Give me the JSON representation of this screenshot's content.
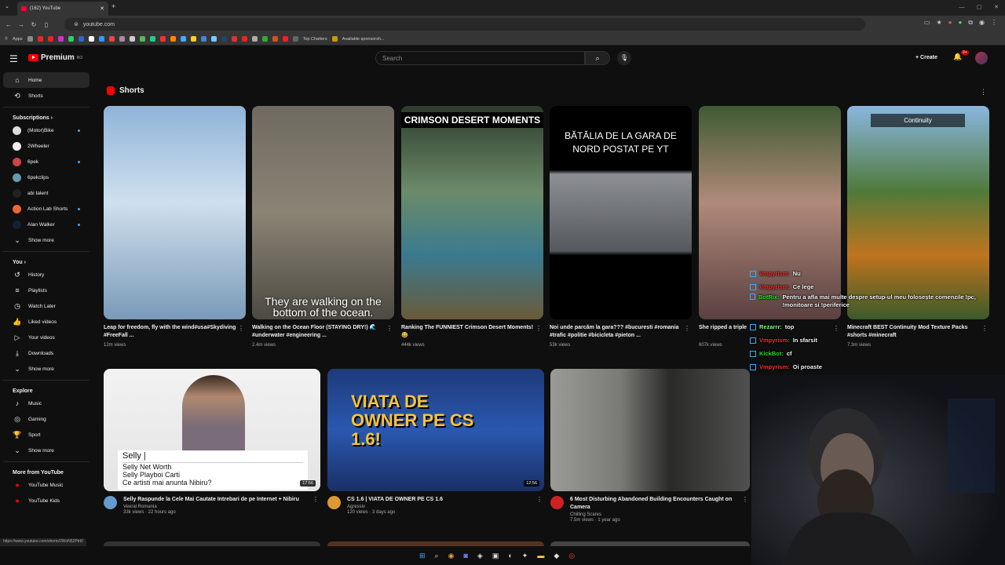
{
  "browser": {
    "tab_title": "(162) YouTube",
    "new_tab": "+",
    "url": "youtube.com",
    "bookmarks": [
      "Apps",
      "Top Chatters",
      "Available sponsorsh..."
    ],
    "window_controls": [
      "—",
      "▢",
      "✕"
    ]
  },
  "header": {
    "logo": "Premium",
    "logo_region": "RO",
    "search_placeholder": "Search",
    "create_label": "Create",
    "notif_count": "9+"
  },
  "sidebar": {
    "main": [
      {
        "label": "Home",
        "icon": "home-icon",
        "glyph": "⌂"
      },
      {
        "label": "Shorts",
        "icon": "shorts-icon",
        "glyph": "⟲"
      }
    ],
    "subs_title": "Subscriptions",
    "subs": [
      {
        "label": "(Motor)Bike",
        "color": "#ddd",
        "dot": true
      },
      {
        "label": "2Wheeler",
        "color": "#eee",
        "dot": false
      },
      {
        "label": "6pek",
        "color": "#c44",
        "dot": true
      },
      {
        "label": "6pekclips",
        "color": "#69a",
        "dot": false
      },
      {
        "label": "abi talent",
        "color": "#222",
        "dot": false
      },
      {
        "label": "Action Lab Shorts",
        "color": "#e63",
        "dot": true
      },
      {
        "label": "Alan Walker",
        "color": "#123",
        "dot": true
      }
    ],
    "show_more": "Show more",
    "you_title": "You",
    "you": [
      {
        "label": "History",
        "glyph": "↺"
      },
      {
        "label": "Playlists",
        "glyph": "≡"
      },
      {
        "label": "Watch Later",
        "glyph": "◷"
      },
      {
        "label": "Liked videos",
        "glyph": "👍"
      },
      {
        "label": "Your videos",
        "glyph": "▷"
      },
      {
        "label": "Downloads",
        "glyph": "⤓"
      }
    ],
    "explore_title": "Explore",
    "explore": [
      {
        "label": "Music",
        "glyph": "♪"
      },
      {
        "label": "Gaming",
        "glyph": "◎"
      },
      {
        "label": "Sport",
        "glyph": "🏆"
      }
    ],
    "more_title": "More from YouTube",
    "more": [
      {
        "label": "YouTube Music"
      },
      {
        "label": "YouTube Kids"
      }
    ]
  },
  "status_url": "https://www.youtube.com/shorts/2WoN52Ptrt0",
  "shorts": {
    "title": "Shorts",
    "items": [
      {
        "title": "Leap for freedom, fly with the wind#usa#Skydiving #FreeFall ...",
        "views": "12m views",
        "bg": "linear-gradient(180deg,#8fb4d8 0%,#cfe0ee 45%,#7a9ab8 100%)",
        "overlay": ""
      },
      {
        "title": "Walking on the Ocean Floor (STAYING DRY!) 🌊 #underwater #engineering ...",
        "views": "2.4m views",
        "bg": "linear-gradient(180deg,#6f6a60 0%,#8a8475 50%,#4d4a42 100%)",
        "overlay": "They are walking on the bottom of the ocean."
      },
      {
        "title": "Ranking The FUNNIEST Crimson Desert Moments! 😂",
        "views": "444k views",
        "bg": "linear-gradient(180deg,#2d3b2c 0%,#6c8b6a 40%,#3a7a8f 70%,#6a5a3a 100%)",
        "overlay": "CRIMSON DESERT MOMENTS"
      },
      {
        "title": "Noi unde parcăm la gara??? #bucuresti #romania #trafic #politie #bicicleta #pieton ...",
        "views": "53k views",
        "bg": "linear-gradient(180deg,#000 0%,#000 30%,#8c8f94 32%,#55585c 68%,#000 70%)",
        "overlay": "BĂTĂLIA DE LA GARA DE NORD POSTAT PE YT"
      },
      {
        "title": "She ripped a triple",
        "views": "607k views",
        "bg": "linear-gradient(180deg,#3f5a33 0%,#b08a7a 45%,#5a4040 100%)",
        "overlay": ""
      },
      {
        "title": "Minecraft BEST Continuity Mod Texture Packs #shorts #minecraft",
        "views": "7.3m views",
        "bg": "linear-gradient(180deg,#8ab6e0 0%,#4f7a3a 40%,#c0741e 70%,#3a5a2a 100%)",
        "overlay": "Continuity"
      }
    ]
  },
  "videos": [
    {
      "title": "Selly Raspunde la Cele Mai Cautate Intrebari de pe Internet + Nibiru",
      "channel": "Veeral Romania",
      "meta": "33k views · 22 hours ago",
      "duration": "17:56",
      "bg": "linear-gradient(180deg,#f2f2f2,#e4e4e4)",
      "av": "#69c",
      "search_text": "Selly |",
      "suggestions": [
        "Selly Net Worth",
        "Selly Playboi Carti",
        "Ce artisti mai anunta Nibiru?"
      ]
    },
    {
      "title": "CS 1.6 | VIATA DE OWNER PE CS 1.6",
      "channel": "Agressiv",
      "meta": "120 views · 3 days ago",
      "duration": "12:56",
      "bg": "linear-gradient(180deg,#1e3a7a,#2a58b0 50%,#1a2f66)",
      "av": "#d93",
      "overlay": "VIATA DE OWNER PE CS 1.6!"
    },
    {
      "title": "6 Most Disturbing Abandoned Building Encounters Caught on Camera",
      "channel": "Chilling Scares",
      "meta": "7.5m views · 1 year ago",
      "duration": "",
      "bg": "linear-gradient(90deg,#9a9a96 0%,#7a7a76 35%,#2a2a28 60%,#505050 100%)",
      "av": "#c22"
    }
  ],
  "chat": [
    {
      "user": "Vmpyrism:",
      "msg": "Nu",
      "color": "#e33"
    },
    {
      "user": "Vmpyrism:",
      "msg": "Ce lege",
      "color": "#e33"
    },
    {
      "user": "BotRix:",
      "msg": "Pentru a afla mai multe despre setup-ul meu folosește comenzile !pc, !monitoare si !periferice",
      "color": "#2d2"
    },
    {
      "user": "Rezarrr:",
      "msg": "top",
      "color": "#7f7"
    },
    {
      "user": "Vmpyrism:",
      "msg": "In sfarsit",
      "color": "#e33"
    },
    {
      "user": "KickBot:",
      "msg": "cf",
      "color": "#2d2"
    },
    {
      "user": "Vmpyrism:",
      "msg": "Oi proaste",
      "color": "#e33"
    }
  ]
}
